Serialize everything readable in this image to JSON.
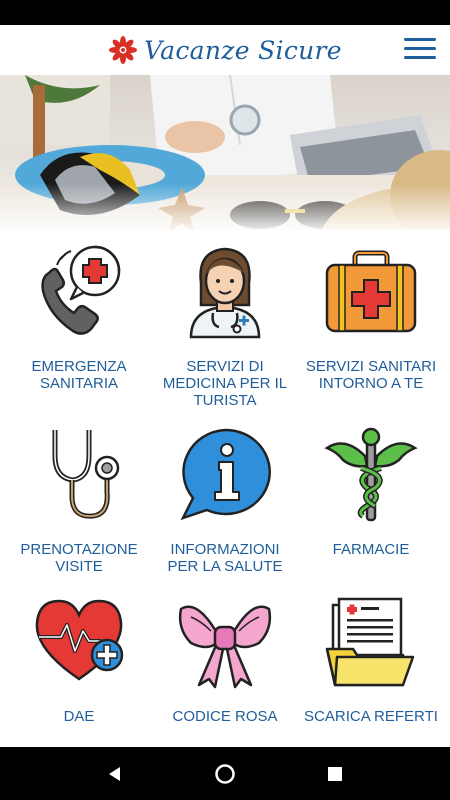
{
  "app": {
    "title": "Vacanze Sicure",
    "brand_color": "#1f5e9a",
    "accent_color": "#d93025"
  },
  "header": {
    "logo_icon": "flower-icon",
    "menu_icon": "hamburger-menu-icon"
  },
  "hero": {
    "image": "doctor-at-desk-with-beach-items-photo"
  },
  "tiles": [
    {
      "label": "EMERGENZA SANITARIA",
      "icon": "phone-medical-cross-icon"
    },
    {
      "label": "SERVIZI DI MEDICINA PER IL TURISTA",
      "icon": "female-doctor-icon"
    },
    {
      "label": "SERVIZI SANITARI INTORNO A TE",
      "icon": "first-aid-kit-icon"
    },
    {
      "label": "PRENOTAZIONE VISITE",
      "icon": "stethoscope-icon"
    },
    {
      "label": "INFORMAZIONI PER LA SALUTE",
      "icon": "info-speech-bubble-icon"
    },
    {
      "label": "FARMACIE",
      "icon": "caduceus-icon"
    },
    {
      "label": "DAE",
      "icon": "heart-defibrillator-icon"
    },
    {
      "label": "CODICE ROSA",
      "icon": "pink-bow-icon"
    },
    {
      "label": "SCARICA REFERTI",
      "icon": "medical-report-folder-icon"
    }
  ],
  "navigation": {
    "back_icon": "back-triangle-icon",
    "home_icon": "home-circle-icon",
    "recents_icon": "recents-square-icon"
  }
}
